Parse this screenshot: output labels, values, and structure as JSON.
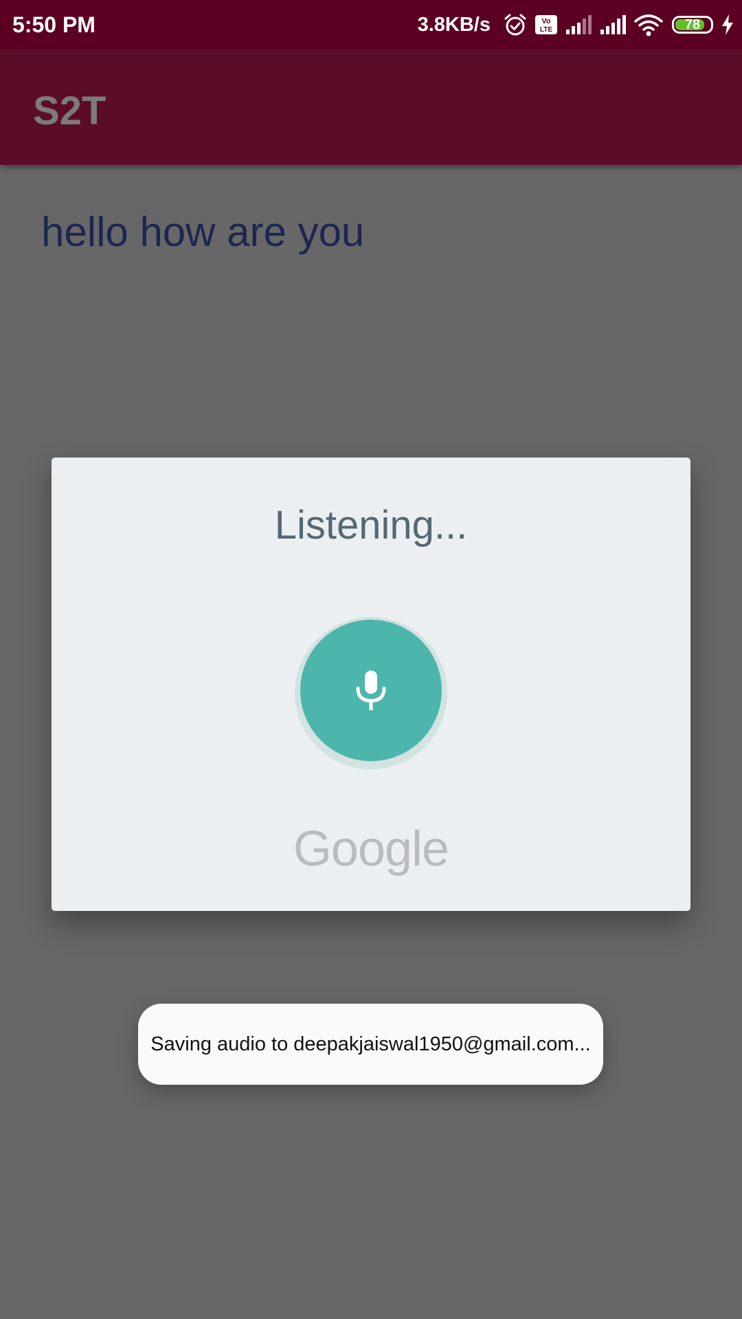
{
  "status_bar": {
    "time": "5:50 PM",
    "network_speed": "3.8KB/s",
    "battery_level": "78",
    "icons": [
      "alarm-icon",
      "volte-icon",
      "signal-icon",
      "signal-icon",
      "wifi-icon",
      "battery-icon",
      "charging-icon"
    ],
    "volte_text_top": "Vo",
    "volte_text_bottom": "LTE"
  },
  "app_bar": {
    "title": "S2T"
  },
  "main": {
    "transcript": "hello how are you"
  },
  "speech_dialog": {
    "title": "Listening...",
    "brand": "Google",
    "mic_icon": "microphone-icon",
    "accent_color": "#4db6ac"
  },
  "toast": {
    "message": "Saving audio to deepakjaiswal1950@gmail.com..."
  },
  "colors": {
    "status_bar": "#5c0023",
    "app_bar": "#5b0c29",
    "scrim_background": "#676767",
    "dialog_background": "#eceff2",
    "battery_fill": "#5fbf2a"
  }
}
